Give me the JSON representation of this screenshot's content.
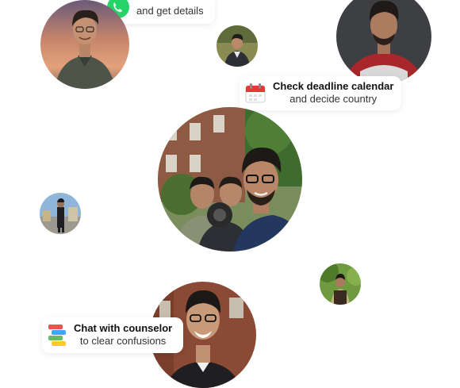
{
  "cards": {
    "top": {
      "subtitle": "and get details"
    },
    "deadline": {
      "title": "Check deadline calendar",
      "subtitle": "and decide country"
    },
    "counselor": {
      "title": "Chat with counselor",
      "subtitle": "to clear confusions"
    }
  },
  "colors": {
    "whatsapp_green": "#25D366",
    "calendar_red": "#E53935"
  },
  "icons": {
    "top": "whatsapp-icon",
    "deadline": "calendar-icon",
    "counselor": "chat-icon"
  }
}
